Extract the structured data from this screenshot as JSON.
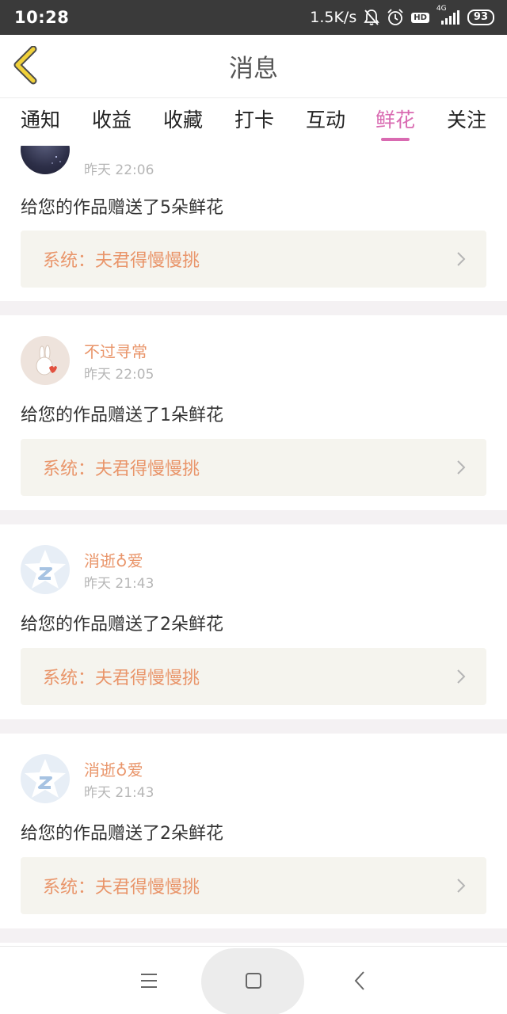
{
  "status_bar": {
    "time": "10:28",
    "speed": "1.5K/s",
    "hd": "HD",
    "network": "4G",
    "battery": "93",
    "icons": [
      "bell-off-icon",
      "alarm-icon",
      "signal-icon"
    ]
  },
  "header": {
    "title": "消息",
    "back_icon": "chevron-left-icon",
    "back_color": "#f0d13a"
  },
  "tabs": [
    {
      "label": "通知",
      "active": false
    },
    {
      "label": "收益",
      "active": false
    },
    {
      "label": "收藏",
      "active": false
    },
    {
      "label": "打卡",
      "active": false
    },
    {
      "label": "互动",
      "active": false
    },
    {
      "label": "鲜花",
      "active": true
    },
    {
      "label": "关注",
      "active": false
    }
  ],
  "colors": {
    "accent": "#d96ab1",
    "name": "#e9956a",
    "system_box": "#f5f4ee"
  },
  "messages": [
    {
      "name": "",
      "time": "昨天 22:06",
      "text": "给您的作品赠送了5朵鲜花",
      "system": "系统：夫君得慢慢挑",
      "avatar": "night-sky-avatar"
    },
    {
      "name": "不过寻常",
      "time": "昨天 22:05",
      "text": "给您的作品赠送了1朵鲜花",
      "system": "系统：夫君得慢慢挑",
      "avatar": "bunny-avatar"
    },
    {
      "name": "消逝♁爱",
      "time": "昨天 21:43",
      "text": "给您的作品赠送了2朵鲜花",
      "system": "系统：夫君得慢慢挑",
      "avatar": "qzone-star-avatar"
    },
    {
      "name": "消逝♁爱",
      "time": "昨天 21:43",
      "text": "给您的作品赠送了2朵鲜花",
      "system": "系统：夫君得慢慢挑",
      "avatar": "qzone-star-avatar"
    }
  ],
  "nav_bar": {
    "icons": [
      "menu-icon",
      "home-square-icon",
      "back-triangle-icon"
    ]
  }
}
